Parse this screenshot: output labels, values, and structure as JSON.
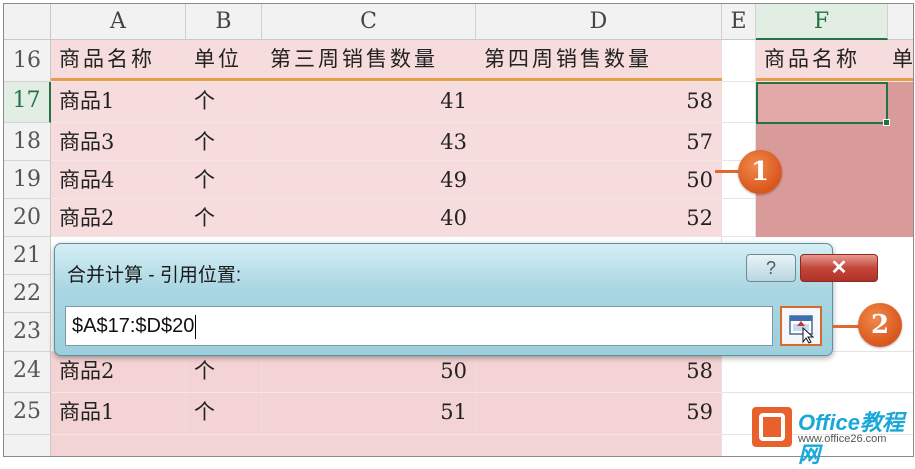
{
  "columns": [
    "A",
    "B",
    "C",
    "D",
    "E",
    "F"
  ],
  "rows": [
    "16",
    "17",
    "18",
    "19",
    "20",
    "21",
    "22",
    "23",
    "24",
    "25"
  ],
  "headers": {
    "a": "商品名称",
    "b": "单位",
    "c": "第三周销售数量",
    "d": "第四周销售数量",
    "f": "商品名称",
    "g": "单"
  },
  "table1": [
    {
      "name": "商品1",
      "unit": "个",
      "w3": "41",
      "w4": "58"
    },
    {
      "name": "商品3",
      "unit": "个",
      "w3": "43",
      "w4": "57"
    },
    {
      "name": "商品4",
      "unit": "个",
      "w3": "49",
      "w4": "50"
    },
    {
      "name": "商品2",
      "unit": "个",
      "w3": "40",
      "w4": "52"
    }
  ],
  "table2": [
    {
      "name": "商品2",
      "unit": "个",
      "w3": "50",
      "w4": "58"
    },
    {
      "name": "商品1",
      "unit": "个",
      "w3": "51",
      "w4": "59"
    }
  ],
  "dialog": {
    "title": "合并计算 - 引用位置:",
    "help": "?",
    "close": "✕",
    "reference": "$A$17:$D$20"
  },
  "callouts": [
    "1",
    "2"
  ],
  "watermark": {
    "main": "Office教程网",
    "sub": "www.office26.com"
  },
  "colors": {
    "accent": "#e06a2b",
    "selection": "#217346",
    "fill": "#f6dcdc",
    "dialog": "#aad7e3"
  }
}
